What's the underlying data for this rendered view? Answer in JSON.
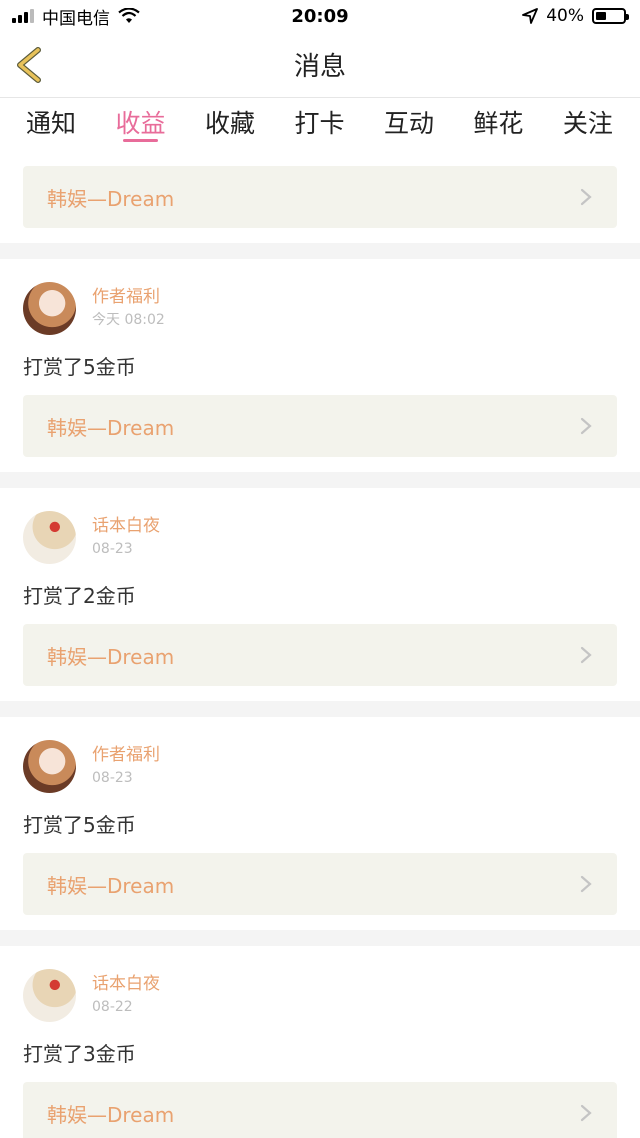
{
  "status_bar": {
    "carrier": "中国电信",
    "time": "20:09",
    "battery": "40%"
  },
  "nav": {
    "title": "消息"
  },
  "tabs": [
    {
      "label": "通知"
    },
    {
      "label": "收益"
    },
    {
      "label": "收藏"
    },
    {
      "label": "打卡"
    },
    {
      "label": "互动"
    },
    {
      "label": "鲜花"
    },
    {
      "label": "关注"
    }
  ],
  "active_tab": "收益",
  "top_link": "韩娱—Dream",
  "items": [
    {
      "name": "作者福利",
      "time": "今天 08:02",
      "message": "打赏了5金币",
      "link": "韩娱—Dream"
    },
    {
      "name": "话本白夜",
      "time": "08-23",
      "message": "打赏了2金币",
      "link": "韩娱—Dream"
    },
    {
      "name": "作者福利",
      "time": "08-23",
      "message": "打赏了5金币",
      "link": "韩娱—Dream"
    },
    {
      "name": "话本白夜",
      "time": "08-22",
      "message": "打赏了3金币",
      "link": "韩娱—Dream"
    }
  ],
  "icons": {
    "back": "chevron-left-icon",
    "wifi": "wifi-icon",
    "location": "location-arrow-icon",
    "battery": "battery-icon",
    "link_chevron": "chevron-right-icon"
  },
  "colors": {
    "accent": "#e86c9a",
    "name": "#e9a270",
    "back_icon": "#e8c25a"
  }
}
